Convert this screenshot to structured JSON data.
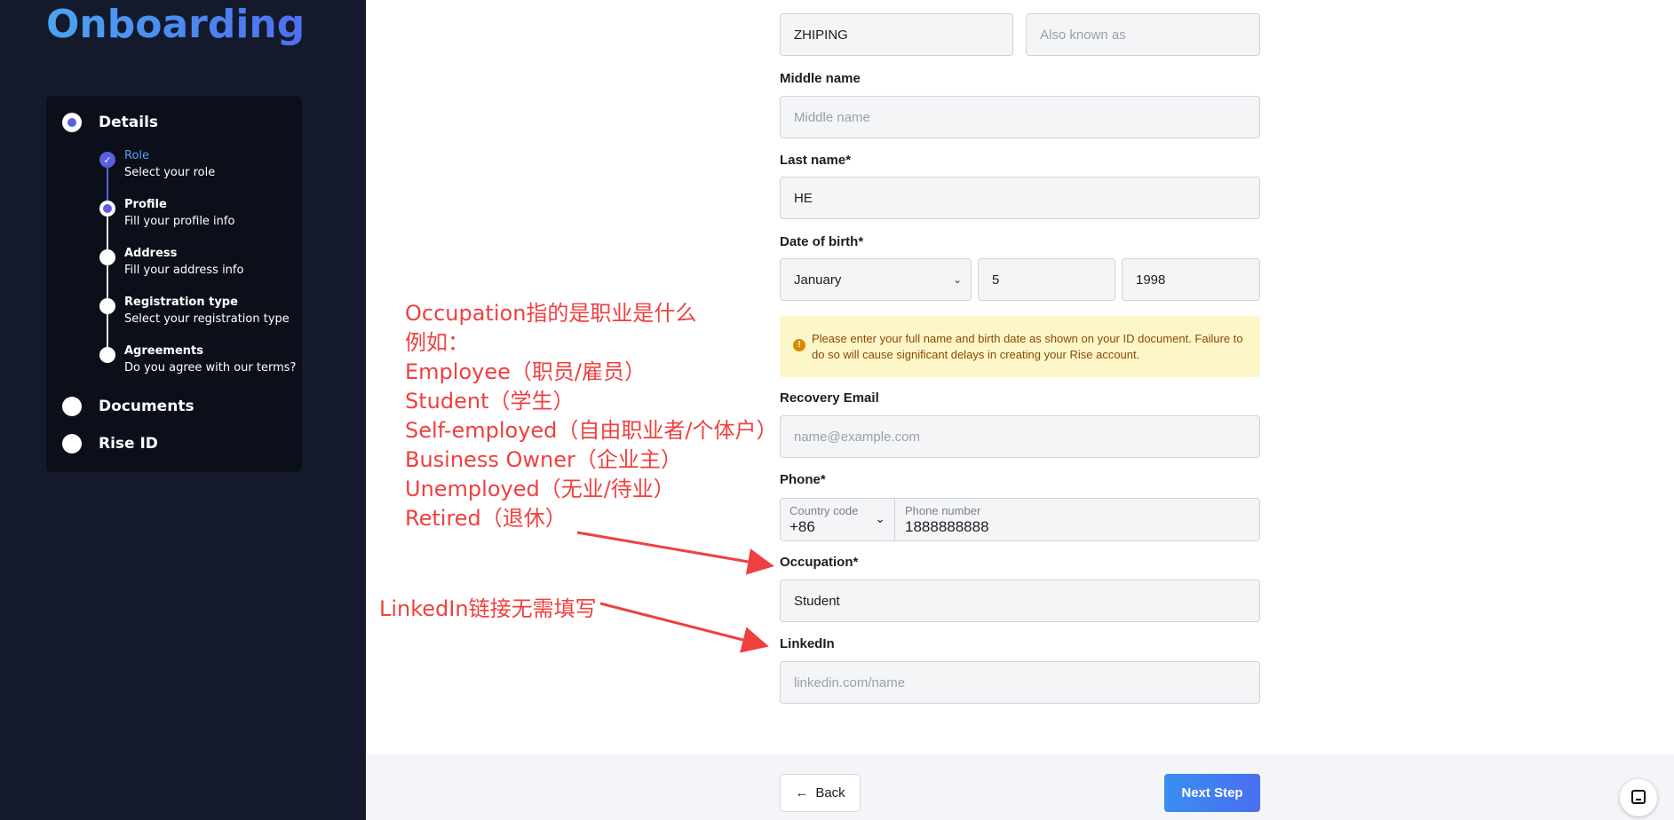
{
  "sidebar": {
    "brand": "Onboarding",
    "steps": [
      {
        "label": "Details"
      },
      {
        "label": "Documents"
      },
      {
        "label": "Rise ID"
      }
    ],
    "substeps": [
      {
        "title": "Role",
        "desc": "Select your role"
      },
      {
        "title": "Profile",
        "desc": "Fill your profile info"
      },
      {
        "title": "Address",
        "desc": "Fill your address info"
      },
      {
        "title": "Registration type",
        "desc": "Select your registration type"
      },
      {
        "title": "Agreements",
        "desc": "Do you agree with our terms?"
      }
    ]
  },
  "form": {
    "first_name_value": "ZHIPING",
    "alias_placeholder": "Also known as",
    "middle_name_label": "Middle name",
    "middle_name_placeholder": "Middle name",
    "last_name_label": "Last name*",
    "last_name_value": "HE",
    "dob_label": "Date of birth*",
    "dob_month": "January",
    "dob_day": "5",
    "dob_year": "1998",
    "notice": "Please enter your full name and birth date as shown on your ID document. Failure to do so will cause significant delays in creating your Rise account.",
    "recovery_email_label": "Recovery Email",
    "recovery_email_placeholder": "name@example.com",
    "phone_label": "Phone*",
    "country_code_label": "Country code",
    "country_code_value": "+86",
    "phone_number_label": "Phone number",
    "phone_number_value": "1888888888",
    "occupation_label": "Occupation*",
    "occupation_value": "Student",
    "linkedin_label": "LinkedIn",
    "linkedin_placeholder": "linkedin.com/name"
  },
  "footer": {
    "back_label": "Back",
    "next_label": "Next Step"
  },
  "annotations": {
    "occupation_lines": [
      "Occupation指的是职业是什么",
      "例如：",
      "Employee（职员/雇员）",
      "Student（学生）",
      "Self-employed（自由职业者/个体户）",
      "Business Owner（企业主）",
      "Unemployed（无业/待业）",
      "Retired（退休）"
    ],
    "linkedin_note": "LinkedIn链接无需填写",
    "color": "#ef4040"
  }
}
